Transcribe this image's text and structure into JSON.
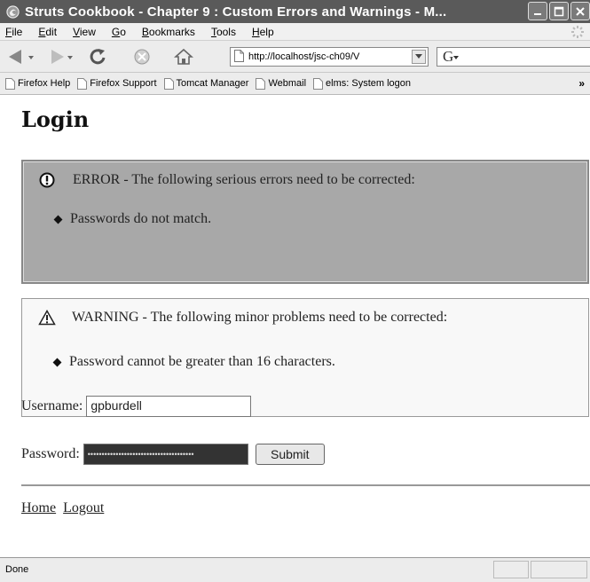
{
  "window": {
    "title": "Struts Cookbook - Chapter 9 : Custom Errors and Warnings - M...",
    "icon": "firefox-icon"
  },
  "menu": [
    "File",
    "Edit",
    "View",
    "Go",
    "Bookmarks",
    "Tools",
    "Help"
  ],
  "menu_underline": [
    "F",
    "E",
    "V",
    "G",
    "B",
    "T",
    "H"
  ],
  "navbar": {
    "url": "http://localhost/jsc-ch09/V",
    "search_logo": "G"
  },
  "bookmarks": [
    "Firefox Help",
    "Firefox Support",
    "Tomcat Manager",
    "Webmail",
    "elms: System logon"
  ],
  "bookmarks_more": "»",
  "page": {
    "title": "Login",
    "error": {
      "heading": "ERROR - The following serious errors need to be corrected:",
      "items": [
        "Passwords do not match."
      ]
    },
    "warning": {
      "heading": "WARNING - The following minor problems need to be corrected:",
      "items": [
        "Password cannot be greater than 16 characters."
      ]
    },
    "form": {
      "username_label": "Username:",
      "username_value": "gpburdell",
      "password_label": "Password:",
      "password_mask": "••••••••••••••••••••••••••••••••••••••",
      "submit_label": "Submit"
    },
    "links": [
      "Home",
      "Logout"
    ]
  },
  "status": {
    "text": "Done"
  }
}
